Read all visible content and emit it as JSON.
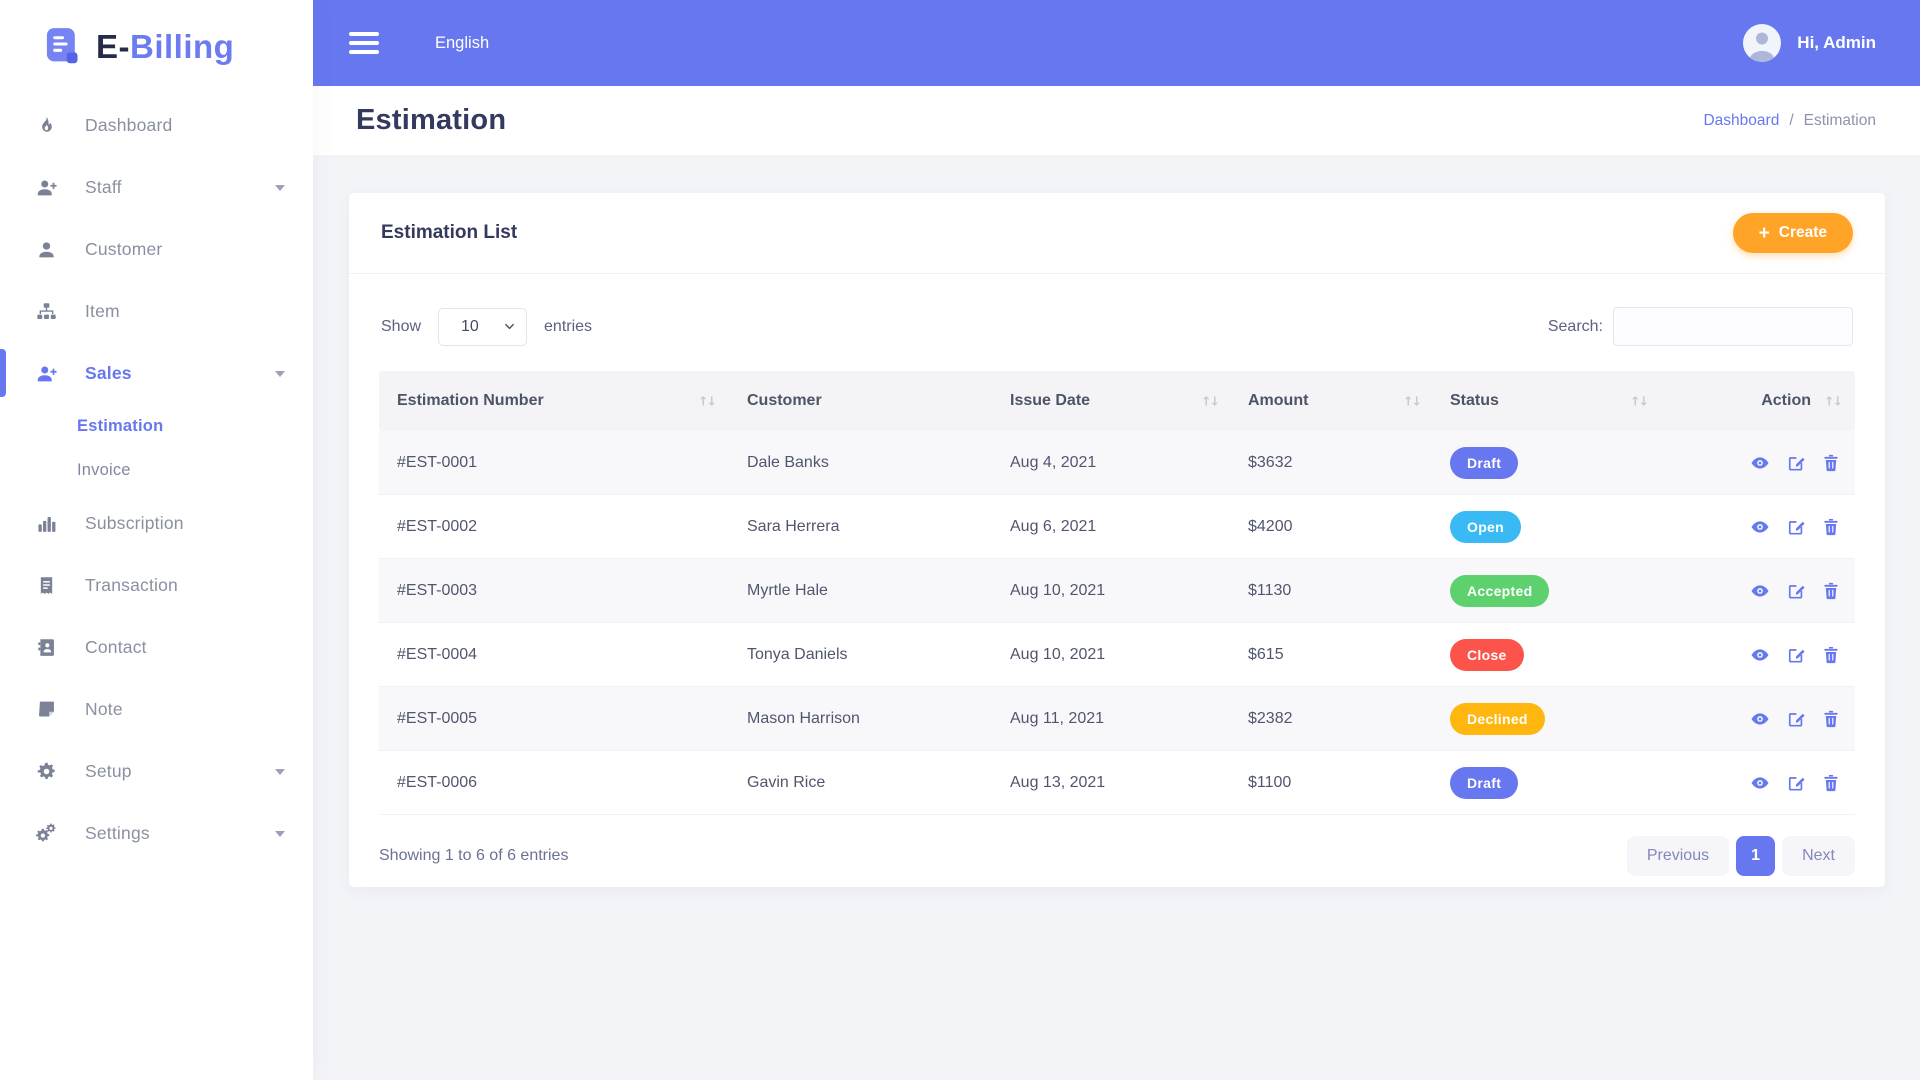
{
  "app": {
    "brand_prefix": "E-",
    "brand_suffix": "Billing"
  },
  "topbar": {
    "language": "English",
    "greeting": "Hi, Admin"
  },
  "sidebar": {
    "items": [
      {
        "label": "Dashboard",
        "icon": "fire-icon"
      },
      {
        "label": "Staff",
        "icon": "user-plus-icon",
        "caret": true
      },
      {
        "label": "Customer",
        "icon": "user-icon"
      },
      {
        "label": "Item",
        "icon": "sitemap-icon"
      },
      {
        "label": "Sales",
        "icon": "user-plus-icon",
        "caret": true,
        "active": true
      },
      {
        "label": "Estimation",
        "sub": true,
        "active": true
      },
      {
        "label": "Invoice",
        "sub": true
      },
      {
        "label": "Subscription",
        "icon": "chart-bar-icon"
      },
      {
        "label": "Transaction",
        "icon": "receipt-icon"
      },
      {
        "label": "Contact",
        "icon": "address-book-icon"
      },
      {
        "label": "Note",
        "icon": "sticky-note-icon"
      },
      {
        "label": "Setup",
        "icon": "gear-icon",
        "caret": true
      },
      {
        "label": "Settings",
        "icon": "gears-icon",
        "caret": true
      }
    ]
  },
  "page": {
    "title": "Estimation",
    "breadcrumb_link": "Dashboard",
    "breadcrumb_sep": "/",
    "breadcrumb_current": "Estimation"
  },
  "card": {
    "title": "Estimation List",
    "create_label": "Create",
    "create_plus": "+",
    "create_color": "#ffa426",
    "show_label": "Show",
    "page_length": "10",
    "entries_label": "entries",
    "search_label": "Search:",
    "search_value": "",
    "table": {
      "columns": [
        {
          "label": "Estimation Number",
          "sortable": true
        },
        {
          "label": "Customer",
          "sortable": false
        },
        {
          "label": "Issue Date",
          "sortable": true
        },
        {
          "label": "Amount",
          "sortable": true
        },
        {
          "label": "Status",
          "sortable": true
        },
        {
          "label": "Action",
          "sortable": true
        }
      ],
      "rows": [
        {
          "number": "#EST-0001",
          "customer": "Dale Banks",
          "issue_date": "Aug 4, 2021",
          "amount": "$3632",
          "status": "Draft",
          "status_color": "#6777ef"
        },
        {
          "number": "#EST-0002",
          "customer": "Sara Herrera",
          "issue_date": "Aug 6, 2021",
          "amount": "$4200",
          "status": "Open",
          "status_color": "#3abaf4"
        },
        {
          "number": "#EST-0003",
          "customer": "Myrtle Hale",
          "issue_date": "Aug 10, 2021",
          "amount": "$1130",
          "status": "Accepted",
          "status_color": "#5ed16f"
        },
        {
          "number": "#EST-0004",
          "customer": "Tonya Daniels",
          "issue_date": "Aug 10, 2021",
          "amount": "$615",
          "status": "Close",
          "status_color": "#fc544b"
        },
        {
          "number": "#EST-0005",
          "customer": "Mason Harrison",
          "issue_date": "Aug 11, 2021",
          "amount": "$2382",
          "status": "Declined",
          "status_color": "#ffb60f"
        },
        {
          "number": "#EST-0006",
          "customer": "Gavin Rice",
          "issue_date": "Aug 13, 2021",
          "amount": "$1100",
          "status": "Draft",
          "status_color": "#6777ef"
        }
      ]
    },
    "footer": {
      "summary": "Showing 1 to 6 of 6 entries",
      "prev_label": "Previous",
      "page": "1",
      "next_label": "Next"
    }
  },
  "colors": {
    "primary": "#6777ef",
    "info": "#3abaf4",
    "success": "#5ed16f",
    "danger": "#fc544b",
    "warning": "#ffa426"
  }
}
